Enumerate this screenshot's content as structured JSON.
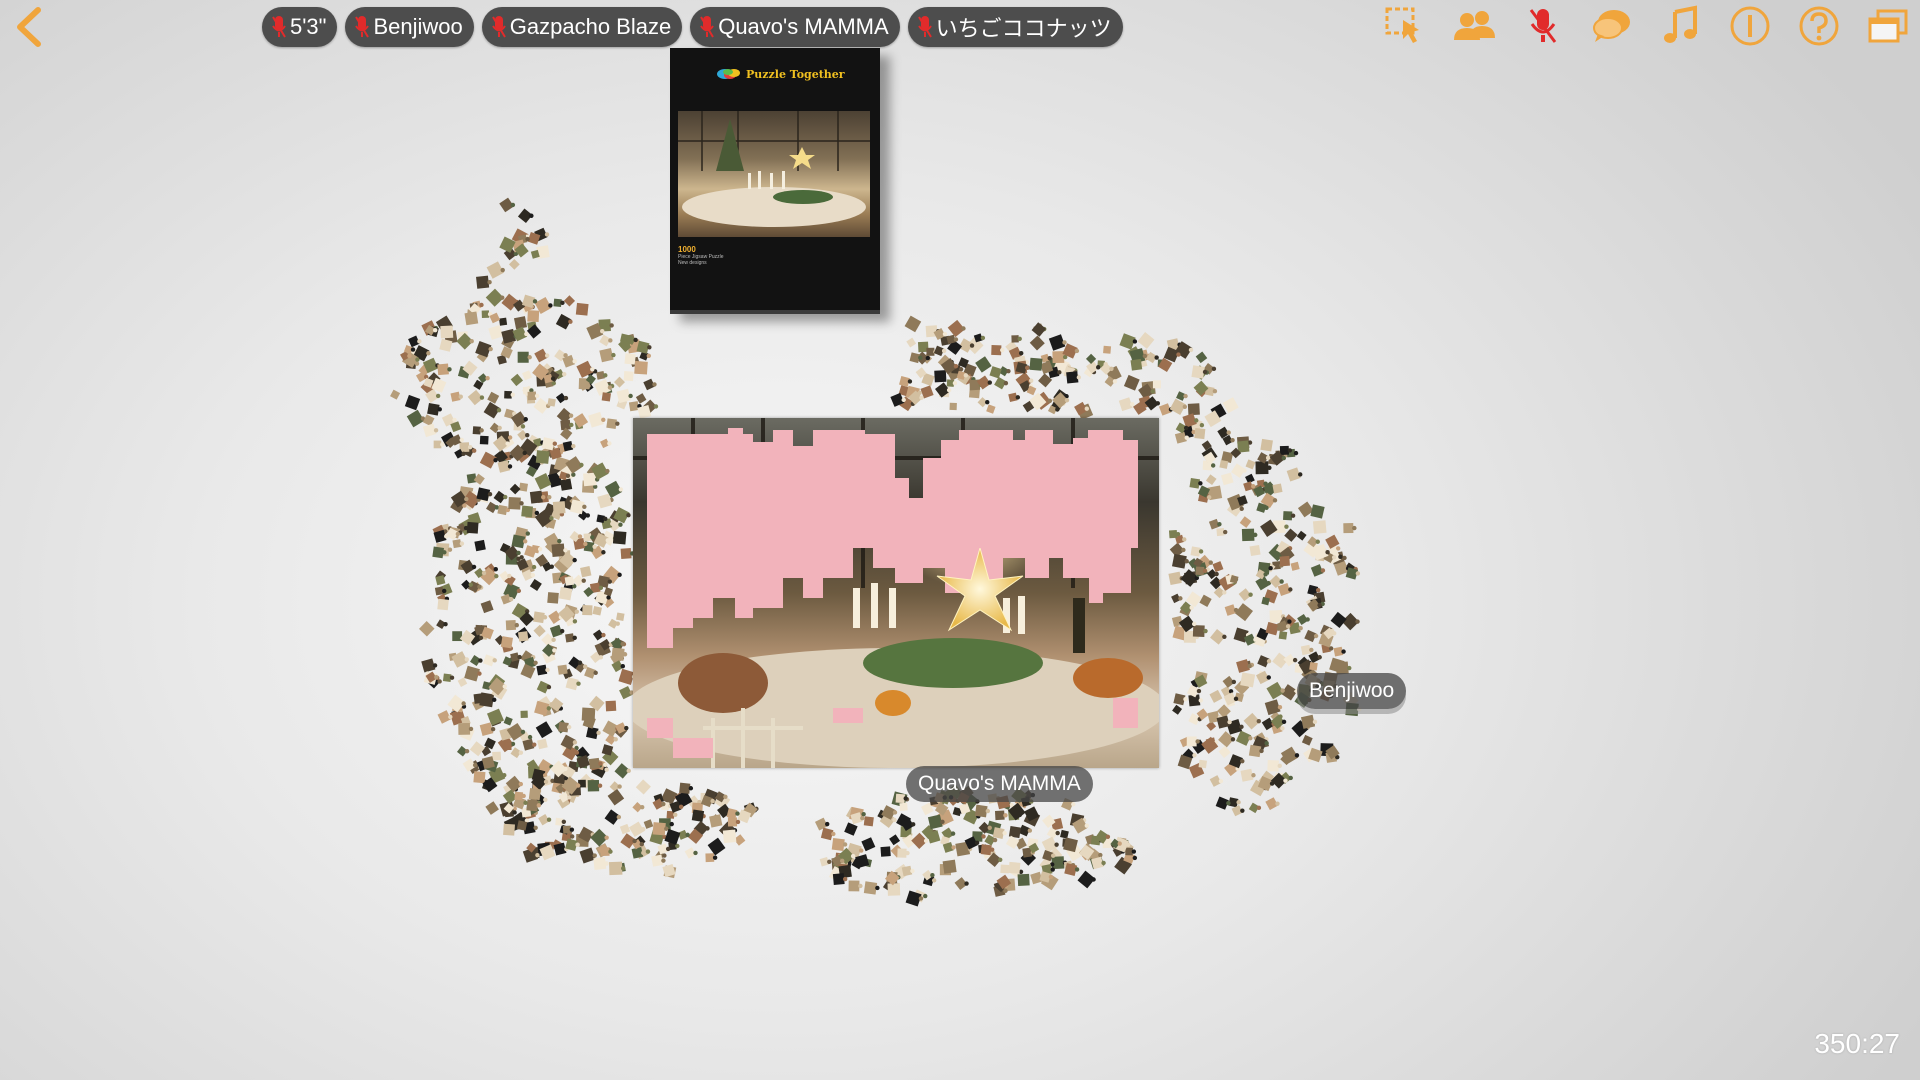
{
  "players": [
    {
      "name": "5'3\"",
      "mic": "muted"
    },
    {
      "name": "Benjiwoo",
      "mic": "muted"
    },
    {
      "name": "Gazpacho Blaze",
      "mic": "muted"
    },
    {
      "name": "Quavo's MAMMA",
      "mic": "muted"
    },
    {
      "name": "いちごココナッツ",
      "mic": "muted"
    }
  ],
  "toolbar": [
    {
      "icon": "cursor-select-icon"
    },
    {
      "icon": "players-icon"
    },
    {
      "icon": "microphone-muted-icon"
    },
    {
      "icon": "chat-bubbles-icon"
    },
    {
      "icon": "music-note-icon"
    },
    {
      "icon": "info-icon"
    },
    {
      "icon": "help-icon"
    },
    {
      "icon": "windows-icon"
    }
  ],
  "colors": {
    "accent": "#f0a53c",
    "mic_muted": "#e12b2b",
    "chip_bg": "#4d4d4d",
    "board_unfilled": "#f2b3bb"
  },
  "box": {
    "title": "Puzzle Together",
    "piece_count": "1000",
    "subtitle_1": "Piece Jigsaw Puzzle",
    "subtitle_2": "New designs"
  },
  "cursors": {
    "benjiwoo": "Benjiwoo",
    "quavo": "Quavo's MAMMA"
  },
  "timer": "350:27"
}
